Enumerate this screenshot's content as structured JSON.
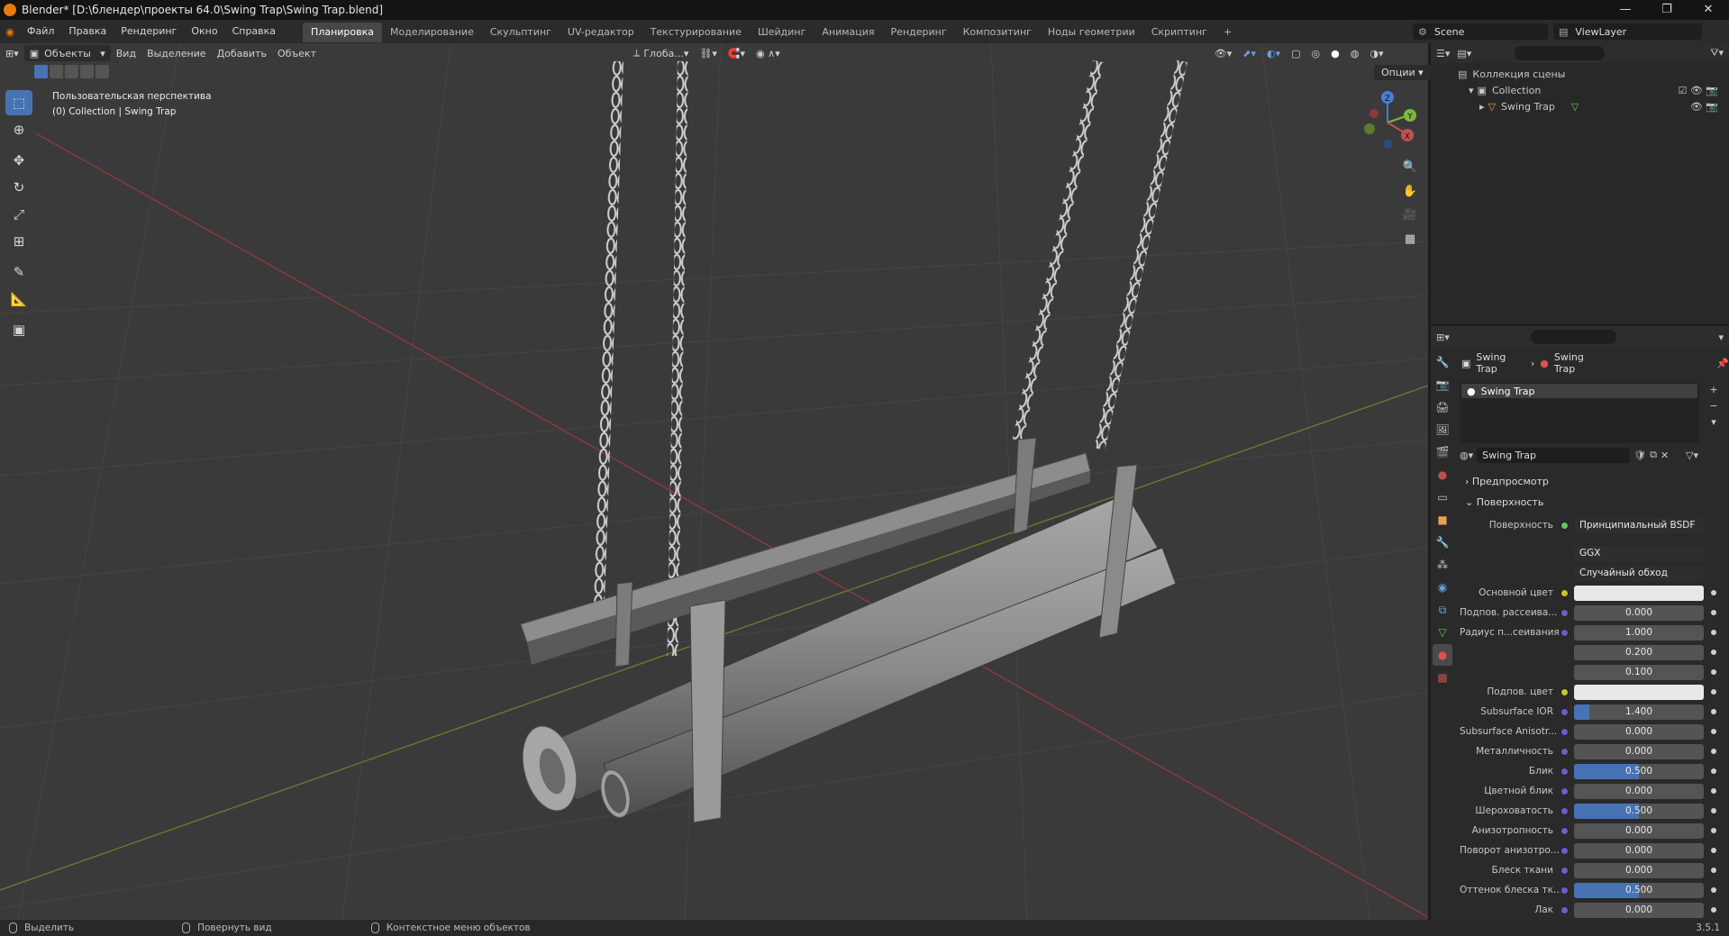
{
  "window": {
    "title": "Blender* [D:\\блендер\\проекты 64.0\\Swing Trap\\Swing Trap.blend]"
  },
  "menu": [
    "Файл",
    "Правка",
    "Рендеринг",
    "Окно",
    "Справка"
  ],
  "workspaces": [
    "Планировка",
    "Моделирование",
    "Скульптинг",
    "UV-редактор",
    "Текстурирование",
    "Шейдинг",
    "Анимация",
    "Рендеринг",
    "Композитинг",
    "Ноды геометрии",
    "Скриптинг"
  ],
  "active_workspace": "Планировка",
  "scene": {
    "name": "Scene",
    "view_layer": "ViewLayer"
  },
  "viewport": {
    "mode": "Объекты",
    "menus": [
      "Вид",
      "Выделение",
      "Добавить",
      "Объект"
    ],
    "orientation": "Глоба...",
    "options_label": "Опции",
    "info_line1": "Пользовательская перспектива",
    "info_line2": "(0) Collection | Swing Trap",
    "gizmo": {
      "x": "X",
      "y": "Y",
      "z": "Z"
    }
  },
  "outliner": {
    "root": "Коллекция сцены",
    "collection": "Collection",
    "object": "Swing Trap"
  },
  "properties": {
    "breadcrumb_object": "Swing Trap",
    "breadcrumb_material": "Swing Trap",
    "slot": "Swing Trap",
    "material_name": "Swing Trap",
    "panel_preview": "Предпросмотр",
    "panel_surface": "Поверхность",
    "surface_label": "Поверхность",
    "surface_value": "Принципиальный BSDF",
    "distribution": "GGX",
    "subsurface_method": "Случайный обход",
    "fields": [
      {
        "label": "Основной цвет",
        "value": "",
        "type": "color",
        "dot": "y"
      },
      {
        "label": "Подпов. рассеива...",
        "value": "0.000",
        "fill": 0,
        "dot": "b"
      },
      {
        "label": "Радиус п...сеивания",
        "value": "1.000",
        "fill": 0,
        "dot": "b"
      },
      {
        "label": "",
        "value": "0.200",
        "fill": 0,
        "dot": ""
      },
      {
        "label": "",
        "value": "0.100",
        "fill": 0,
        "dot": ""
      },
      {
        "label": "Подпов. цвет",
        "value": "",
        "type": "color",
        "dot": "y"
      },
      {
        "label": "Subsurface IOR",
        "value": "1.400",
        "fill": 0.12,
        "dot": "b"
      },
      {
        "label": "Subsurface Anisotr...",
        "value": "0.000",
        "fill": 0,
        "dot": "b"
      },
      {
        "label": "Металличность",
        "value": "0.000",
        "fill": 0,
        "dot": "b"
      },
      {
        "label": "Блик",
        "value": "0.500",
        "fill": 0.5,
        "dot": "b"
      },
      {
        "label": "Цветной блик",
        "value": "0.000",
        "fill": 0,
        "dot": "b"
      },
      {
        "label": "Шероховатость",
        "value": "0.500",
        "fill": 0.5,
        "dot": "b"
      },
      {
        "label": "Анизотропность",
        "value": "0.000",
        "fill": 0,
        "dot": "b"
      },
      {
        "label": "Поворот анизотро...",
        "value": "0.000",
        "fill": 0,
        "dot": "b"
      },
      {
        "label": "Блеск ткани",
        "value": "0.000",
        "fill": 0,
        "dot": "b"
      },
      {
        "label": "Оттенок блеска тк...",
        "value": "0.500",
        "fill": 0.5,
        "dot": "b"
      },
      {
        "label": "Лак",
        "value": "0.000",
        "fill": 0,
        "dot": "b"
      }
    ]
  },
  "status": {
    "select": "Выделить",
    "rotate": "Повернуть вид",
    "context": "Контекстное меню объектов",
    "version": "3.5.1"
  },
  "colors": {
    "accent": "#4772b3",
    "x_axis": "#c85050",
    "y_axis": "#7fb840",
    "z_axis": "#4a7ed8",
    "brand": "#e87d0d"
  }
}
